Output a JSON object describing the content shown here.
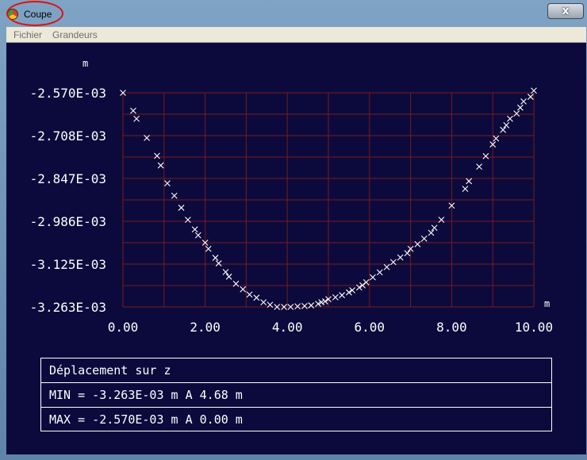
{
  "window": {
    "title": "Coupe",
    "close_label": "x"
  },
  "menu": {
    "items": [
      "Fichier",
      "Grandeurs"
    ]
  },
  "chart_data": {
    "type": "scatter",
    "ylabel_unit": "m",
    "xlabel_unit": "m",
    "xlim": [
      0,
      10
    ],
    "ylim": [
      -0.003263,
      -0.00257
    ],
    "x_ticks": [
      "0.00",
      "2.00",
      "4.00",
      "6.00",
      "8.00",
      "10.00"
    ],
    "y_ticks": [
      "-2.570E-03",
      "-2.708E-03",
      "-2.847E-03",
      "-2.986E-03",
      "-3.125E-03",
      "-3.263E-03"
    ],
    "grid": true,
    "marker": "x",
    "colors": {
      "background": "#0c0a3c",
      "grid": "#7a1a1a",
      "marker": "#ffffff"
    },
    "x": [
      0.0,
      0.25,
      0.33,
      0.58,
      0.83,
      0.92,
      1.08,
      1.25,
      1.42,
      1.58,
      1.75,
      1.83,
      2.0,
      2.08,
      2.25,
      2.33,
      2.5,
      2.58,
      2.75,
      2.92,
      3.08,
      3.25,
      3.42,
      3.58,
      3.75,
      3.92,
      4.08,
      4.25,
      4.42,
      4.58,
      4.75,
      4.83,
      4.92,
      5.0,
      5.17,
      5.33,
      5.5,
      5.58,
      5.75,
      5.83,
      5.92,
      6.08,
      6.25,
      6.42,
      6.58,
      6.75,
      6.92,
      7.0,
      7.17,
      7.33,
      7.5,
      7.58,
      7.75,
      8.0,
      8.33,
      8.42,
      8.67,
      8.83,
      9.0,
      9.08,
      9.25,
      9.33,
      9.42,
      9.58,
      9.67,
      9.75,
      9.92,
      10.0
    ],
    "y": [
      -0.00257,
      -0.002628,
      -0.002654,
      -0.002716,
      -0.002774,
      -0.002805,
      -0.002863,
      -0.002903,
      -0.002942,
      -0.002981,
      -0.003012,
      -0.003031,
      -0.003055,
      -0.003075,
      -0.003104,
      -0.003122,
      -0.00315,
      -0.003165,
      -0.003188,
      -0.003206,
      -0.003223,
      -0.003233,
      -0.003248,
      -0.003256,
      -0.003263,
      -0.003263,
      -0.003263,
      -0.003261,
      -0.00326,
      -0.003258,
      -0.003253,
      -0.003248,
      -0.003245,
      -0.003238,
      -0.003232,
      -0.003225,
      -0.003216,
      -0.003209,
      -0.0032,
      -0.003193,
      -0.003183,
      -0.003167,
      -0.003151,
      -0.003134,
      -0.003118,
      -0.003103,
      -0.003089,
      -0.003075,
      -0.00306,
      -0.003042,
      -0.003023,
      -0.003007,
      -0.002981,
      -0.002935,
      -0.002881,
      -0.002856,
      -0.002809,
      -0.002775,
      -0.002737,
      -0.002718,
      -0.00269,
      -0.002675,
      -0.002654,
      -0.002637,
      -0.002618,
      -0.002598,
      -0.002583,
      -0.002563
    ]
  },
  "status": {
    "title": "Déplacement sur z",
    "min_text": "MIN = -3.263E-03 m  A 4.68 m",
    "max_text": "MAX = -2.570E-03 m  A 0.00 m"
  }
}
